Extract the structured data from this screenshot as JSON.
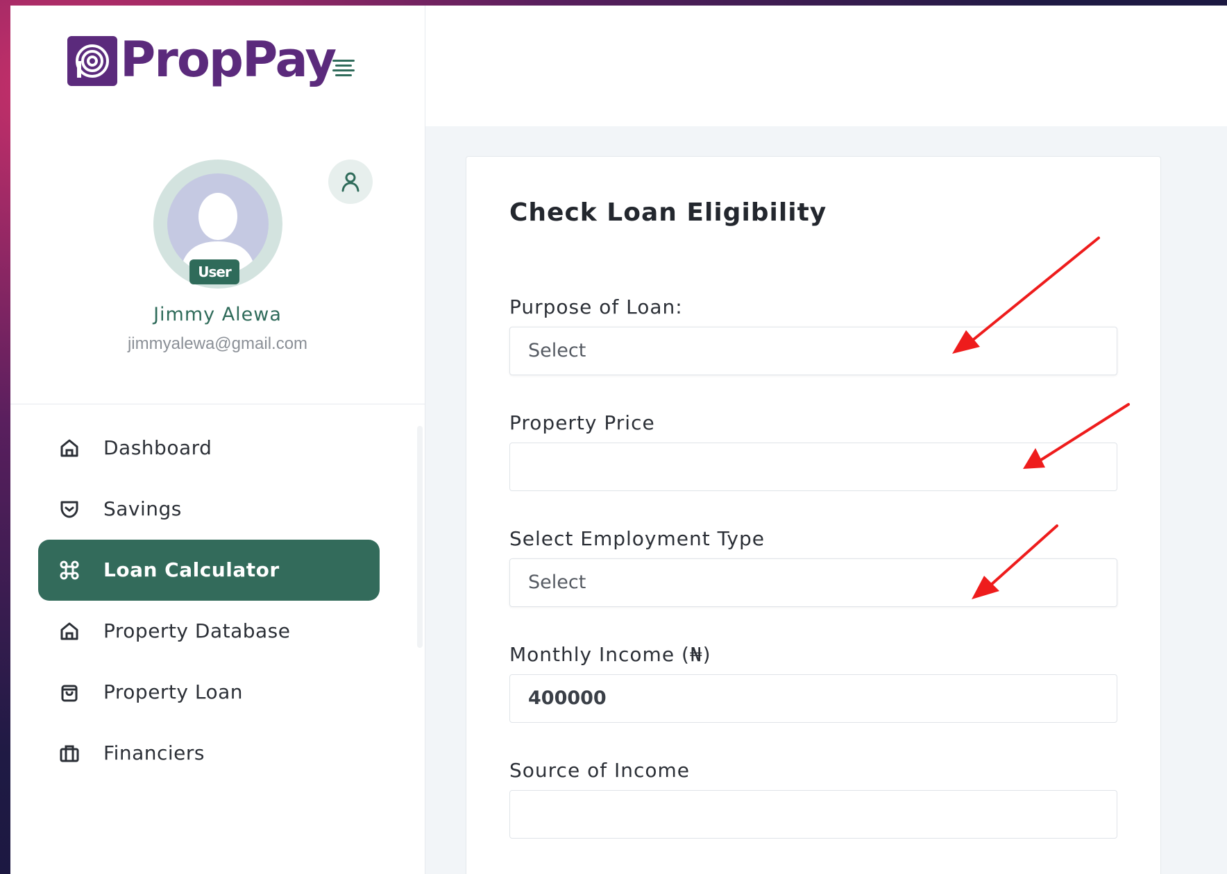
{
  "brand": {
    "name": "PropPay"
  },
  "profile": {
    "role": "User",
    "name": "Jimmy Alewa",
    "email": "jimmyalewa@gmail.com"
  },
  "nav": [
    {
      "label": "Dashboard",
      "icon": "home-icon",
      "active": false
    },
    {
      "label": "Savings",
      "icon": "shield-icon",
      "active": false
    },
    {
      "label": "Loan Calculator",
      "icon": "command-icon",
      "active": true
    },
    {
      "label": "Property Database",
      "icon": "home-icon",
      "active": false
    },
    {
      "label": "Property Loan",
      "icon": "bag-icon",
      "active": false
    },
    {
      "label": "Financiers",
      "icon": "briefcase-icon",
      "active": false
    }
  ],
  "form": {
    "title": "Check Loan Eligibility",
    "fields": [
      {
        "label": "Purpose of Loan:",
        "value": "Select",
        "type": "select"
      },
      {
        "label": "Property Price",
        "value": "",
        "type": "input"
      },
      {
        "label": "Select Employment Type",
        "value": "Select",
        "type": "select"
      },
      {
        "label": "Monthly Income (₦)",
        "value": "400000",
        "type": "input"
      },
      {
        "label": "Source of Income",
        "value": "",
        "type": "input"
      }
    ]
  },
  "colors": {
    "brand_purple": "#5b2a7c",
    "accent_green": "#336b5b",
    "annotation_red": "#ee1c1c"
  }
}
